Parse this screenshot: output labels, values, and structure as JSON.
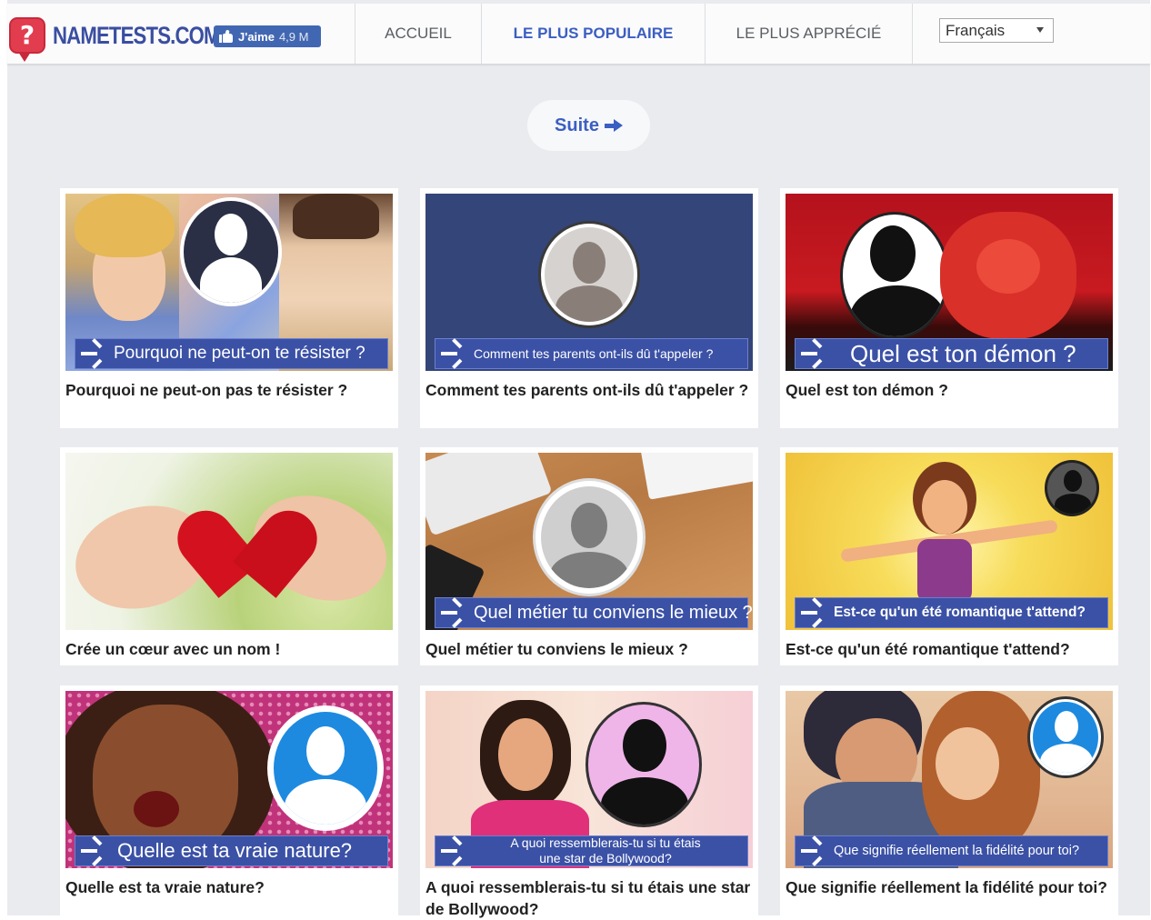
{
  "brand": {
    "name": "NAMETESTS.COM",
    "logo_glyph": "?",
    "color": "#3a4ea1",
    "accent": "#e23c4f"
  },
  "facebook": {
    "like_label": "J'aime",
    "like_count": "4,9 M",
    "color": "#4267b2"
  },
  "nav": {
    "items": [
      {
        "label": "ACCUEIL",
        "active": false
      },
      {
        "label": "LE PLUS POPULAIRE",
        "active": true
      },
      {
        "label": "LE PLUS APPRÉCIÉ",
        "active": false
      }
    ]
  },
  "language": {
    "selected": "Français"
  },
  "suite_label": "Suite",
  "quizzes": [
    {
      "title": "Pourquoi ne peut-on pas te résister ?",
      "banner": "Pourquoi ne peut-on te résister ?"
    },
    {
      "title": "Comment tes parents ont-ils dû t'appeler ?",
      "banner": "Comment tes parents ont-ils dû t'appeler ?"
    },
    {
      "title": "Quel est ton démon ?",
      "banner": "Quel est ton démon ?"
    },
    {
      "title": "Crée un cœur avec un nom !",
      "banner": ""
    },
    {
      "title": "Quel métier tu conviens le mieux ?",
      "banner": "Quel métier tu conviens le mieux ?"
    },
    {
      "title": "Est-ce qu'un été romantique t'attend?",
      "banner": "Est-ce qu'un été romantique t'attend?"
    },
    {
      "title": "Quelle est ta vraie nature?",
      "banner": "Quelle est ta vraie nature?"
    },
    {
      "title": "A quoi ressemblerais-tu si tu étais une star de Bollywood?",
      "banner": "A quoi ressemblerais-tu si tu étais une star de Bollywood?"
    },
    {
      "title": "Que signifie réellement la fidélité pour toi?",
      "banner": "Que signifie réellement la fidélité pour toi?"
    }
  ]
}
